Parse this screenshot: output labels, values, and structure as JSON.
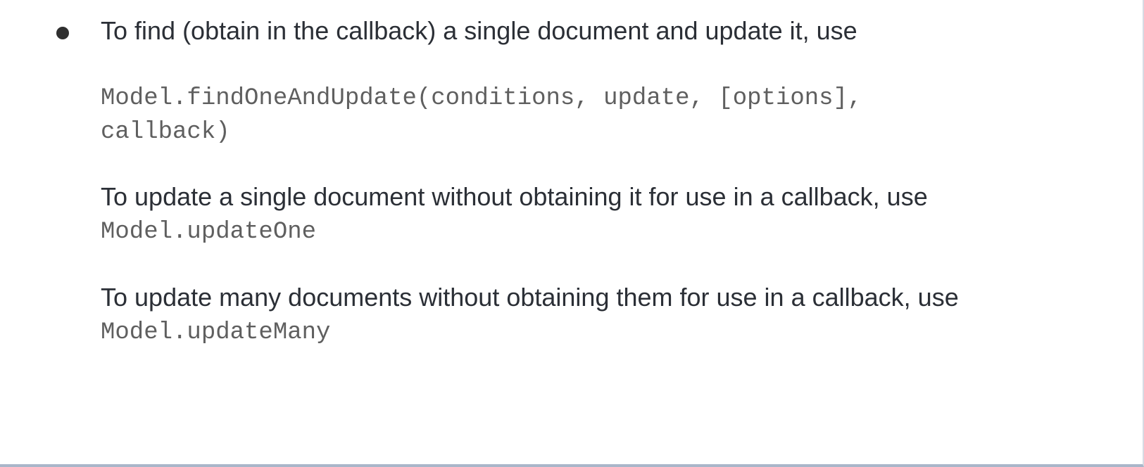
{
  "slide": {
    "item1": {
      "text": "To find (obtain in the callback) a single document and update it, use",
      "code_line1": "Model.findOneAndUpdate(conditions, update, [options],",
      "code_line2": "callback)"
    },
    "item2": {
      "text": "To update a single document without obtaining it for use in a callback, use",
      "code": "Model.updateOne"
    },
    "item3": {
      "text": "To update many documents without obtaining them for use in a callback, use",
      "code": "Model.updateMany"
    }
  }
}
